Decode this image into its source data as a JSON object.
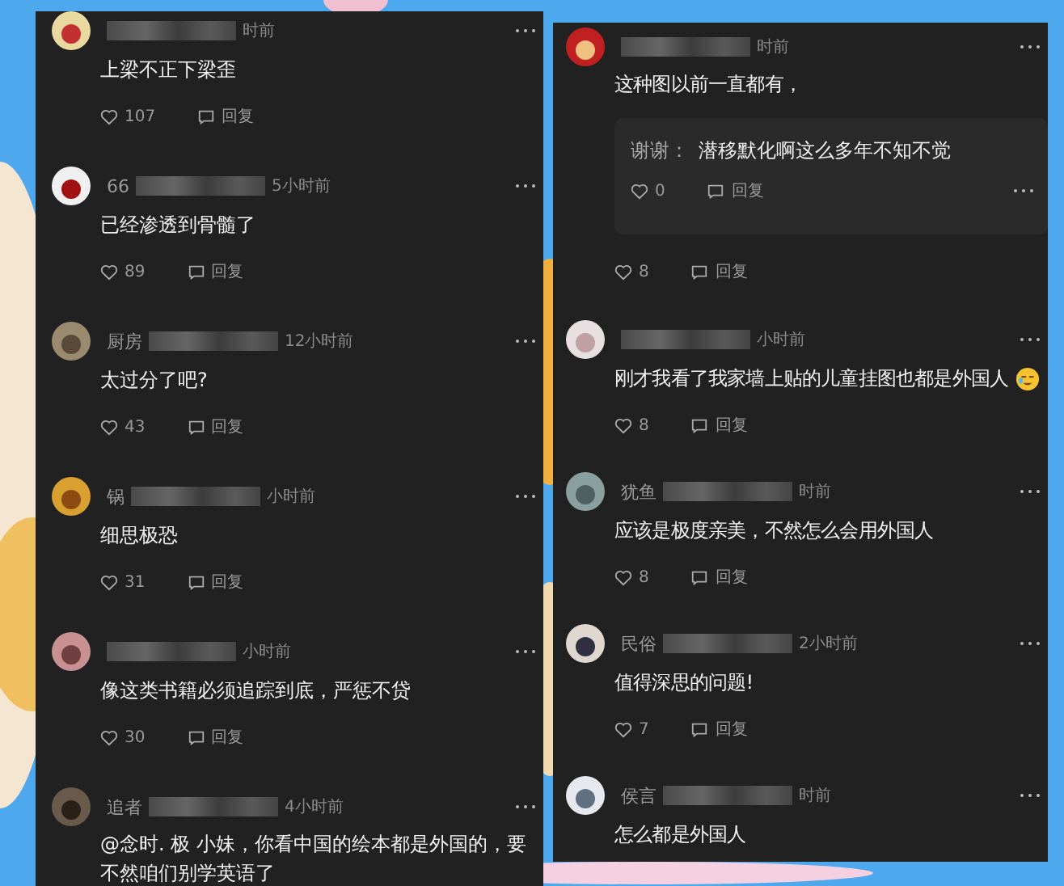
{
  "panels": [
    {
      "comments": [
        {
          "time": "时前",
          "text": "上梁不正下梁歪",
          "likes": "107",
          "reply": "回复"
        },
        {
          "name": "66",
          "time": "5小时前",
          "text": "已经渗透到骨髓了",
          "likes": "89",
          "reply": "回复"
        },
        {
          "name": "厨房",
          "time": "12小时前",
          "text": "太过分了吧?",
          "likes": "43",
          "reply": "回复"
        },
        {
          "name": "锅",
          "time": "小时前",
          "text": "细思极恐",
          "likes": "31",
          "reply": "回复"
        },
        {
          "time": "小时前",
          "text": "像这类书籍必须追踪到底，严惩不贷",
          "likes": "30",
          "reply": "回复"
        },
        {
          "name": "追者",
          "time": "4小时前",
          "text": "@念时. 极 小妹，你看中国的绘本都是外国的，要不然咱们别学英语了"
        }
      ]
    },
    {
      "comments": [
        {
          "time": "时前",
          "text": "这种图以前一直都有，",
          "subreply": {
            "author": "谢谢：",
            "text": "潜移默化啊这么多年不知不觉",
            "likes": "0",
            "reply": "回复"
          },
          "likes": "8",
          "reply": "回复"
        },
        {
          "time": "小时前",
          "text": "刚才我看了我家墙上贴的儿童挂图也都是外国人",
          "likes": "8",
          "reply": "回复"
        },
        {
          "name": "犹鱼",
          "time": "时前",
          "text": "应该是极度亲美，不然怎么会用外国人",
          "likes": "8",
          "reply": "回复"
        },
        {
          "name": "民俗",
          "time": "2小时前",
          "text": "值得深思的问题!",
          "likes": "7",
          "reply": "回复"
        },
        {
          "name": "侯言",
          "time": "时前",
          "text": "怎么都是外国人"
        }
      ]
    }
  ]
}
